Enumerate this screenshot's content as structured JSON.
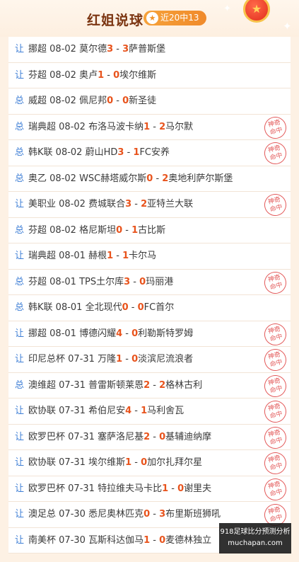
{
  "header": {
    "title": "红姐说球",
    "record_label": "近20中13",
    "star_icon": "★",
    "medal_icon": "★"
  },
  "stamp_text": [
    "神",
    "奇",
    "命中"
  ],
  "watermark": {
    "line1": "918足球比分预测分析",
    "line2": "muchapan.com"
  },
  "rows": [
    {
      "type": "让",
      "league": "挪超",
      "date": "08-02",
      "home": "莫尔德",
      "hs": "3",
      "as": "3",
      "away": "萨普斯堡",
      "hit": false
    },
    {
      "type": "让",
      "league": "芬超",
      "date": "08-02",
      "home": "奥卢",
      "hs": "1",
      "as": "0",
      "away": "埃尔维斯",
      "hit": false
    },
    {
      "type": "总",
      "league": "威超",
      "date": "08-02",
      "home": "佩尼邦",
      "hs": "0",
      "as": "0",
      "away": "新圣徒",
      "hit": false
    },
    {
      "type": "总",
      "league": "瑞典超",
      "date": "08-02",
      "home": "布洛马波卡纳",
      "hs": "1",
      "as": "2",
      "away": "马尔默",
      "hit": true
    },
    {
      "type": "总",
      "league": "韩K联",
      "date": "08-02",
      "home": "蔚山HD",
      "hs": "3",
      "as": "1",
      "away": "FC安养",
      "hit": true
    },
    {
      "type": "总",
      "league": "奥乙",
      "date": "08-02",
      "home": "WSC赫塔威尔斯",
      "hs": "0",
      "as": "2",
      "away": "奥地利萨尔斯堡",
      "hit": false
    },
    {
      "type": "让",
      "league": "美职业",
      "date": "08-02",
      "home": "费城联合",
      "hs": "3",
      "as": "2",
      "away": "亚特兰大联",
      "hit": true
    },
    {
      "type": "总",
      "league": "芬超",
      "date": "08-02",
      "home": "格尼斯坦",
      "hs": "0",
      "as": "1",
      "away": "古比斯",
      "hit": false
    },
    {
      "type": "让",
      "league": "瑞典超",
      "date": "08-01",
      "home": "赫根",
      "hs": "1",
      "as": "1",
      "away": "卡尔马",
      "hit": false
    },
    {
      "type": "总",
      "league": "芬超",
      "date": "08-01",
      "home": "TPS土尔库",
      "hs": "3",
      "as": "0",
      "away": "玛丽港",
      "hit": true
    },
    {
      "type": "总",
      "league": "韩K联",
      "date": "08-01",
      "home": "全北现代",
      "hs": "0",
      "as": "0",
      "away": "FC首尔",
      "hit": false
    },
    {
      "type": "让",
      "league": "挪超",
      "date": "08-01",
      "home": "博德闪耀",
      "hs": "4",
      "as": "0",
      "away": "利勒斯特罗姆",
      "hit": true
    },
    {
      "type": "让",
      "league": "印尼总杯",
      "date": "07-31",
      "home": "万隆",
      "hs": "1",
      "as": "0",
      "away": "淡滨尼流浪者",
      "hit": true
    },
    {
      "type": "总",
      "league": "澳维超",
      "date": "07-31",
      "home": "普雷斯顿莱恩",
      "hs": "2",
      "as": "2",
      "away": "格林古利",
      "hit": true
    },
    {
      "type": "让",
      "league": "欧协联",
      "date": "07-31",
      "home": "希伯尼安",
      "hs": "4",
      "as": "1",
      "away": "马利舍瓦",
      "hit": true
    },
    {
      "type": "让",
      "league": "欧罗巴杯",
      "date": "07-31",
      "home": "塞萨洛尼基",
      "hs": "2",
      "as": "0",
      "away": "基辅迪纳摩",
      "hit": true
    },
    {
      "type": "让",
      "league": "欧协联",
      "date": "07-31",
      "home": "埃尔维斯",
      "hs": "1",
      "as": "0",
      "away": "加尔扎拜尔星",
      "hit": true
    },
    {
      "type": "让",
      "league": "欧罗巴杯",
      "date": "07-31",
      "home": "特拉维夫马卡比",
      "hs": "1",
      "as": "0",
      "away": "谢里夫",
      "hit": true
    },
    {
      "type": "让",
      "league": "澳足总",
      "date": "07-30",
      "home": "悉尼奥林匹克",
      "hs": "0",
      "as": "3",
      "away": "布里斯班狮吼",
      "hit": true
    },
    {
      "type": "让",
      "league": "南美杯",
      "date": "07-30",
      "home": "瓦斯科达伽马",
      "hs": "1",
      "as": "0",
      "away": "麦德林独立",
      "hit": false
    }
  ]
}
